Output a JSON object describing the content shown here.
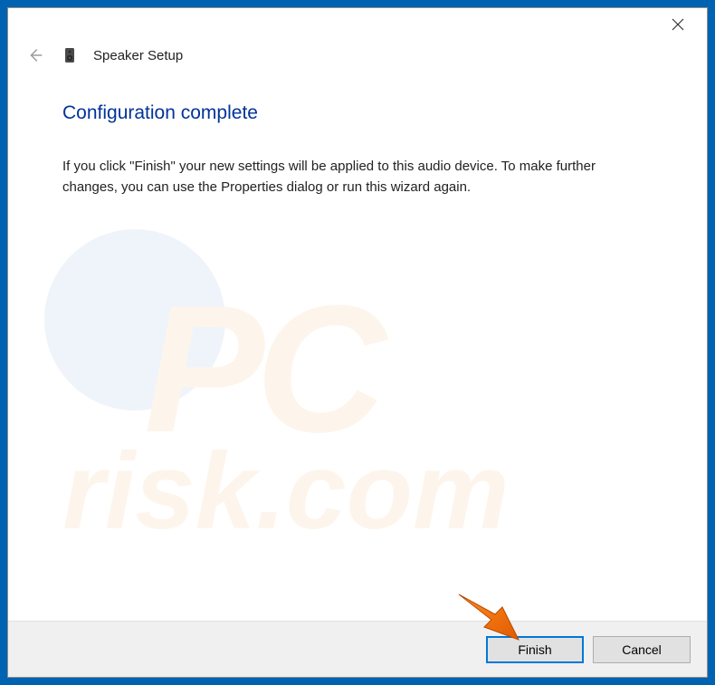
{
  "window": {
    "title": "Speaker Setup"
  },
  "page": {
    "heading": "Configuration complete",
    "body": "If you click \"Finish\" your new settings will be applied to this audio device.  To make further changes, you can use the Properties dialog or run this wizard again."
  },
  "footer": {
    "finish_label": "Finish",
    "cancel_label": "Cancel"
  },
  "watermark": {
    "line1": "PC",
    "line2": "risk.com"
  }
}
